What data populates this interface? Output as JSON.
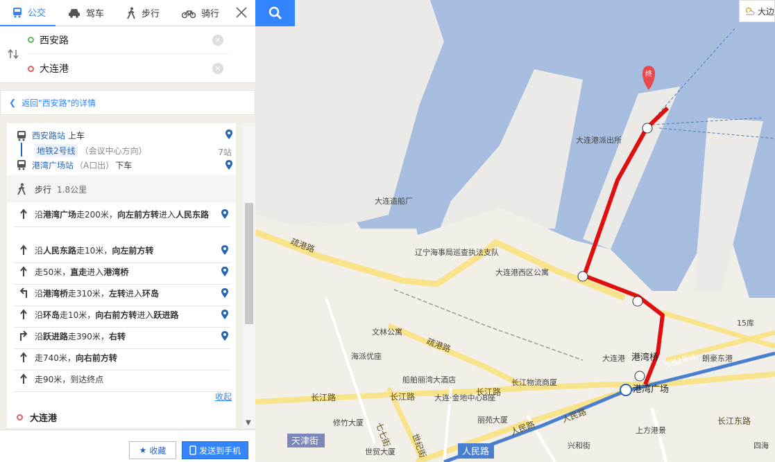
{
  "modes": [
    {
      "label": "公交",
      "icon": "bus-icon",
      "active": true
    },
    {
      "label": "驾车",
      "icon": "car-icon"
    },
    {
      "label": "步行",
      "icon": "walk-icon"
    },
    {
      "label": "骑行",
      "icon": "bike-icon"
    }
  ],
  "route_inputs": {
    "start": "西安路",
    "end": "大连港",
    "clear_glyph": "×"
  },
  "back_link": "返回\"西安路\"的详情",
  "transit": {
    "board_station": "西安路站",
    "board_action": "上车",
    "line_name": "地铁2号线",
    "line_direction": "（会议中心方向）",
    "stop_count": "7站",
    "alight_station": "港湾广场站",
    "alight_exit": "（A口出）",
    "alight_action": "下车",
    "walk_label": "步行",
    "walk_distance": "1.8公里"
  },
  "steps": [
    {
      "arrow": "straight",
      "parts": [
        [
          "沿",
          false
        ],
        [
          "港湾广场",
          true
        ],
        [
          "走200米，",
          false
        ],
        [
          "向左前方转",
          true
        ],
        [
          "进入",
          false
        ],
        [
          "人民东路",
          true
        ]
      ]
    },
    {
      "arrow": "straight",
      "parts": [
        [
          "沿",
          false
        ],
        [
          "人民东路",
          true
        ],
        [
          "走10米，",
          false
        ],
        [
          "向左前方转",
          true
        ]
      ]
    },
    {
      "arrow": "straight",
      "parts": [
        [
          "走50米，",
          false
        ],
        [
          "直走",
          true
        ],
        [
          "进入",
          false
        ],
        [
          "港湾桥",
          true
        ]
      ]
    },
    {
      "arrow": "left",
      "parts": [
        [
          "沿",
          false
        ],
        [
          "港湾桥",
          true
        ],
        [
          "走310米，",
          false
        ],
        [
          "左转",
          true
        ],
        [
          "进入",
          false
        ],
        [
          "环岛",
          true
        ]
      ]
    },
    {
      "arrow": "straight",
      "parts": [
        [
          "沿",
          false
        ],
        [
          "环岛",
          true
        ],
        [
          "走10米，",
          false
        ],
        [
          "向右前方转",
          true
        ],
        [
          "进入",
          false
        ],
        [
          "跃进路",
          true
        ]
      ]
    },
    {
      "arrow": "right",
      "parts": [
        [
          "沿",
          false
        ],
        [
          "跃进路",
          true
        ],
        [
          "走390米，",
          false
        ],
        [
          "右转",
          true
        ]
      ]
    },
    {
      "arrow": "straight",
      "parts": [
        [
          "走740米，",
          false
        ],
        [
          "向右前方转",
          true
        ]
      ]
    },
    {
      "arrow": "straight",
      "parts": [
        [
          "走90米，到达终点",
          false
        ]
      ]
    }
  ],
  "collapse_label": "收起",
  "destination_label": "大连港",
  "actions": {
    "favorite": "收藏",
    "send_to_phone": "发送到手机"
  },
  "weather_text": "大边",
  "map_labels": {
    "end_marker": "终",
    "pois": [
      "大连港派出所",
      "大连造船厂",
      "辽宁海事局巡查执法支队",
      "大连港西区公寓",
      "15库",
      "文林公寓",
      "海派优座",
      "大连港",
      "船舶丽湾大酒店",
      "长江物流商厦",
      "大连·金地中心B座",
      "修竹大厦",
      "丽苑大厦",
      "上方港景",
      "世贸大厦",
      "朗豪东港",
      "四海",
      "兴和街"
    ],
    "roads": [
      "疏港路",
      "疏港路",
      "长江路",
      "长江路",
      "长江路",
      "人民路",
      "人民路",
      "天津街",
      "长江东路",
      "世纪街",
      "七七街"
    ],
    "landmarks": [
      "港湾桥",
      "港湾广场",
      "人民路",
      "地铁2号线"
    ]
  },
  "colors": {
    "accent": "#3385ff",
    "route": "#e00f0f",
    "water": "#a6bde0",
    "land": "#f2efe9",
    "main_road": "#f8e38a"
  }
}
